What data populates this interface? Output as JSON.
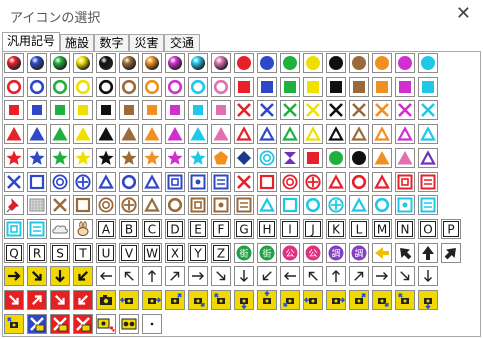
{
  "window": {
    "title": "アイコンの選択"
  },
  "tabs": [
    "汎用記号",
    "施設",
    "数字",
    "災害",
    "交通"
  ],
  "active_tab": 0,
  "colors": {
    "red": "#e8202a",
    "blue": "#2f48c8",
    "green": "#20b040",
    "yellow": "#f0e000",
    "black": "#101010",
    "brown": "#9a6a3a",
    "magenta": "#d030d0",
    "cyan": "#20c8e8",
    "orange": "#f09020",
    "navy": "#1a3a8a",
    "pink": "#e070b0",
    "purple": "#7030c0"
  },
  "rows": [
    [
      "ball:red",
      "ball:blue",
      "ball:green",
      "ball:yellow",
      "ball:black",
      "ball:brown",
      "ball:orange",
      "ball:magenta",
      "ball:cyan",
      "ball:pink",
      "circle:red",
      "circle:blue",
      "circle:green",
      "circle:yellow",
      "circle:black",
      "circle:brown",
      "circle:orange",
      "circle:magenta",
      "circle:cyan"
    ],
    [
      "ring:red",
      "ring:blue",
      "ring:green",
      "ring:yellow",
      "ring:black",
      "ring:brown",
      "ring:orange",
      "ring:magenta",
      "ring:cyan",
      "ring:pink",
      "square:red",
      "square:blue",
      "square:green",
      "square:yellow",
      "square:black",
      "square:brown",
      "square:orange",
      "square:magenta",
      "square:cyan"
    ],
    [
      "square-sm:red",
      "square-sm:blue",
      "square-sm:green",
      "square-sm:yellow",
      "square-sm:black",
      "square-sm:brown",
      "square-sm:orange",
      "square-sm:magenta",
      "square-sm:cyan",
      "square-sm:pink",
      "x:red",
      "x:blue",
      "x:green",
      "x:yellow",
      "x:black",
      "x:brown",
      "x:orange",
      "x:magenta",
      "x:cyan"
    ],
    [
      "triangle:red",
      "triangle:blue",
      "triangle:green",
      "triangle:yellow",
      "triangle:black",
      "triangle:brown",
      "triangle:orange",
      "triangle:magenta",
      "triangle:cyan",
      "triangle:pink",
      "tri-outline:red",
      "tri-outline:blue",
      "tri-outline:green",
      "tri-outline:yellow",
      "tri-outline:black",
      "tri-outline:brown",
      "tri-outline:orange",
      "tri-outline:magenta",
      "tri-outline:cyan"
    ],
    [
      "star:red",
      "star:blue",
      "star:green",
      "star:yellow",
      "star:black",
      "star:brown",
      "star:orange",
      "star:magenta",
      "star:cyan",
      "pentagon:orange",
      "diamond:navy",
      "target:cyan",
      "spool:purple",
      "square:red",
      "circle:green",
      "circle:black",
      "triangle:orange",
      "triangle:pink",
      "tri-outline:purple"
    ],
    [
      "x:blue",
      "box-outline:blue",
      "target:blue",
      "plus-circle:blue",
      "tri-outline:blue",
      "ring:blue",
      "tri-outline:blue",
      "box-square:blue",
      "box-dot:blue",
      "box-lines:blue",
      "x:red",
      "box-outline:red",
      "target:red",
      "plus-circle:red",
      "tri-outline:red",
      "ring:red",
      "tri-outline:red",
      "box-square:red",
      "box-lines:red"
    ],
    [
      "pin:red",
      "grid:gray",
      "x:brown",
      "box-outline:brown",
      "target:brown",
      "plus-circle:brown",
      "tri-outline:brown",
      "ring:brown",
      "box-square:brown",
      "box-dot:brown",
      "box-lines:brown",
      "tri-outline:cyan",
      "box-outline:cyan",
      "ring:cyan",
      "plus-circle:cyan",
      "tri-outline:cyan",
      "ring:cyan",
      "box-dot:cyan",
      "box-lines:cyan"
    ],
    [
      "box-square:cyan",
      "box-lines:cyan",
      "cloud:gray",
      "rabbit:brown",
      "letter:A",
      "letter:B",
      "letter:C",
      "letter:D",
      "letter:E",
      "letter:F",
      "letter:G",
      "letter:H",
      "letter:I",
      "letter:J",
      "letter:K",
      "letter:L",
      "letter:M",
      "letter:N",
      "letter:O",
      "letter:P"
    ],
    [
      "letter:Q",
      "letter:R",
      "letter:S",
      "letter:T",
      "letter:U",
      "letter:V",
      "letter:W",
      "letter:X",
      "letter:Y",
      "letter:Z",
      "badge:街",
      "badge:街",
      "badge:公",
      "badge:公",
      "badge:調",
      "badge:調",
      "arrow:left",
      "arrow:up-left",
      "arrow:up",
      "arrow:up-right"
    ],
    [
      "arrow-y:right",
      "arrow-y:down-right",
      "arrow-y:down",
      "arrow-y:down-left",
      "arrow-o:left",
      "arrow-o:up-left",
      "arrow-o:up",
      "arrow-o:up-right",
      "arrow-o:right",
      "arrow-o:down-right",
      "arrow-o:down",
      "arrow-o:down-left",
      "arrow-o:left",
      "arrow-o:up-left",
      "arrow-o:up",
      "arrow-o:up-right",
      "arrow-o:right",
      "arrow-o:down-right",
      "arrow-o:down"
    ],
    [
      "arrow-r:down-right",
      "arrow-r:up-right",
      "arrow-r:down-right",
      "arrow-r:down-left",
      "camera:gray",
      "camera-arrow:left",
      "camera-arrow:right",
      "camera-arrow:up-right",
      "camera-arrow:down-right",
      "camera-arrow:up-left",
      "camera-arrow:down",
      "camera-arrow:up",
      "camera-arrow:down-left",
      "camera-arrow:left",
      "camera-arrow:right",
      "camera-arrow:up-right",
      "camera-arrow:down-right",
      "camera-arrow:up-left",
      "camera-arrow:down"
    ],
    [
      "camera-arrow:up-left",
      "camera-cross:blue",
      "camera-cross:red",
      "camera-cross:red",
      "camera-dots:red",
      "camera-film:black",
      "dot:black"
    ]
  ],
  "row_counts": [
    19,
    19,
    19,
    19,
    19,
    19,
    19,
    20,
    20,
    19,
    19,
    7
  ]
}
